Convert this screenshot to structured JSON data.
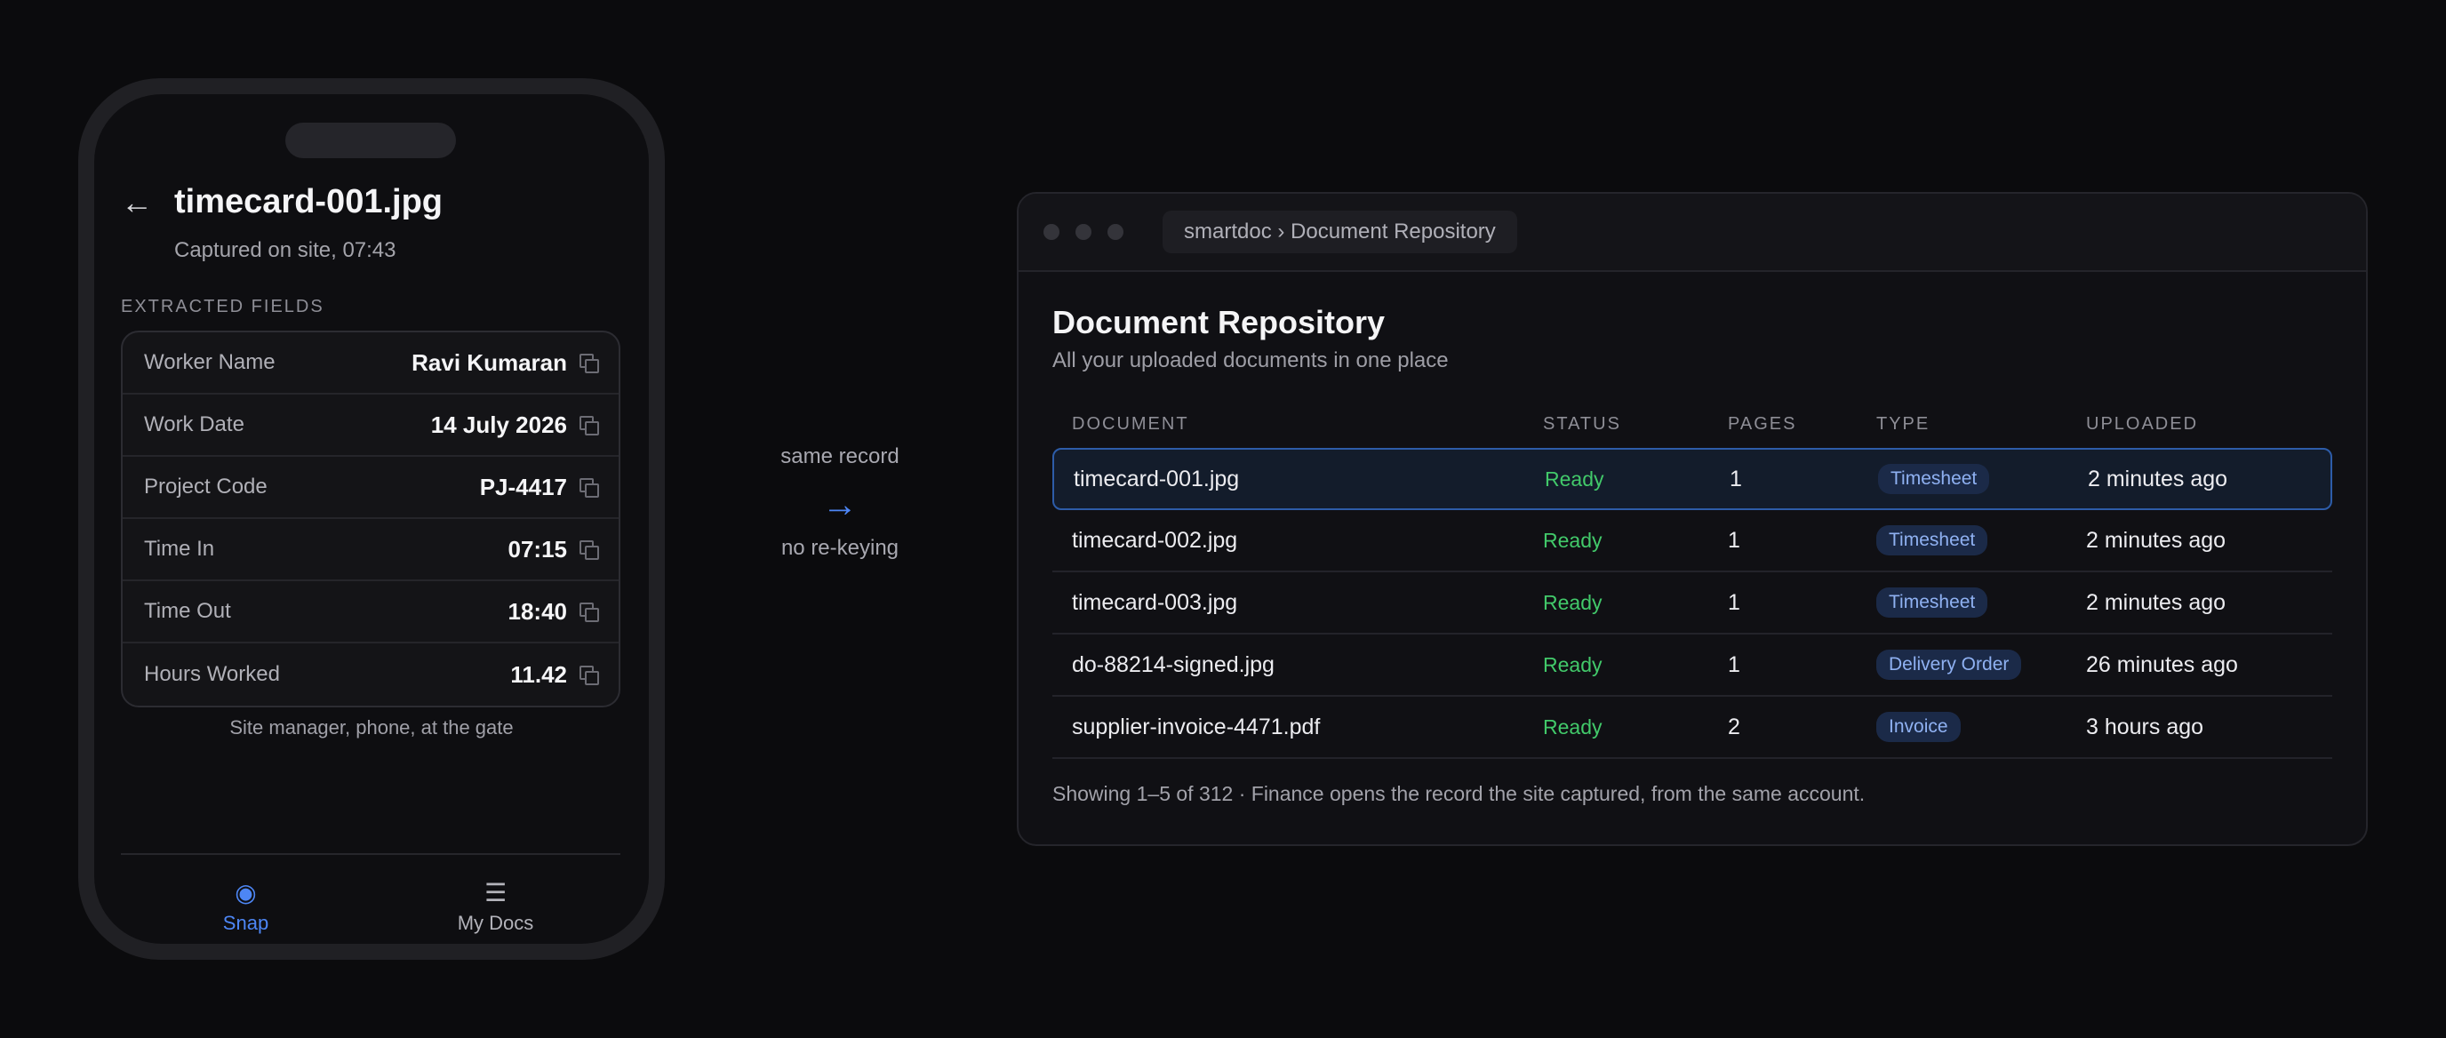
{
  "phone": {
    "back_glyph": "←",
    "title": "timecard-001.jpg",
    "subtitle": "Captured on site, 07:43",
    "section_label": "EXTRACTED FIELDS",
    "fields": [
      {
        "label": "Worker Name",
        "value": "Ravi Kumaran"
      },
      {
        "label": "Work Date",
        "value": "14 July 2026"
      },
      {
        "label": "Project Code",
        "value": "PJ-4417"
      },
      {
        "label": "Time In",
        "value": "07:15"
      },
      {
        "label": "Time Out",
        "value": "18:40"
      },
      {
        "label": "Hours Worked",
        "value": "11.42"
      }
    ],
    "caption": "Site manager, phone, at the gate",
    "tabs": [
      {
        "glyph": "◉",
        "label": "Snap",
        "icon": "camera-icon",
        "active": true
      },
      {
        "glyph": "☰",
        "label": "My Docs",
        "icon": "list-icon",
        "active": false
      }
    ]
  },
  "connector": {
    "top": "same record",
    "arrow": "→",
    "bottom": "no re-keying"
  },
  "window": {
    "address": "smartdoc › Document Repository",
    "title": "Document Repository",
    "subtitle": "All your uploaded documents in one place",
    "columns": [
      "DOCUMENT",
      "STATUS",
      "PAGES",
      "TYPE",
      "UPLOADED"
    ],
    "rows": [
      {
        "document": "timecard-001.jpg",
        "status": "Ready",
        "pages": "1",
        "type": "Timesheet",
        "uploaded": "2 minutes ago"
      },
      {
        "document": "timecard-002.jpg",
        "status": "Ready",
        "pages": "1",
        "type": "Timesheet",
        "uploaded": "2 minutes ago"
      },
      {
        "document": "timecard-003.jpg",
        "status": "Ready",
        "pages": "1",
        "type": "Timesheet",
        "uploaded": "2 minutes ago"
      },
      {
        "document": "do-88214-signed.jpg",
        "status": "Ready",
        "pages": "1",
        "type": "Delivery Order",
        "uploaded": "26 minutes ago"
      },
      {
        "document": "supplier-invoice-4471.pdf",
        "status": "Ready",
        "pages": "2",
        "type": "Invoice",
        "uploaded": "3 hours ago"
      }
    ],
    "footer": "Showing 1–5 of 312 · Finance opens the record the site captured, from the same account."
  },
  "colors": {
    "accent": "#4d86f5",
    "ready": "#42c96a",
    "badge_bg": "#1b2a48",
    "badge_text": "#8fb1f2",
    "background": "#0b0b0d"
  }
}
